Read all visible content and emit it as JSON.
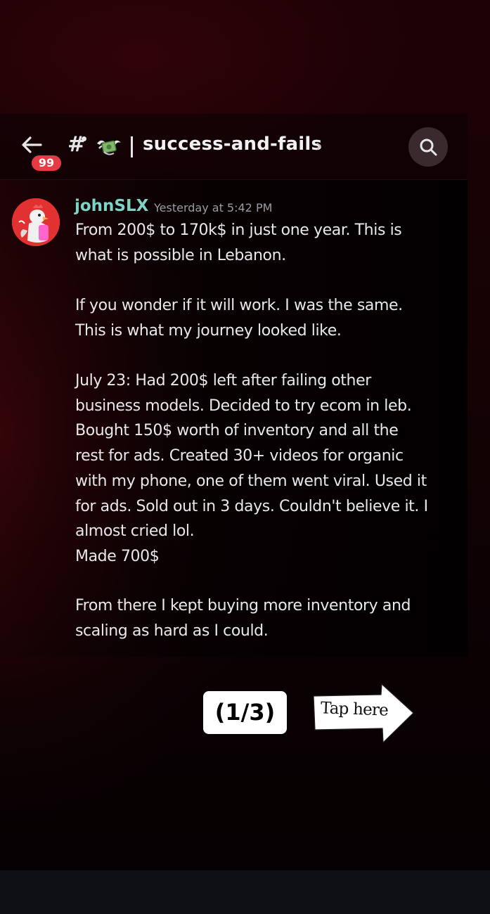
{
  "header": {
    "back_icon": "arrow-left-icon",
    "unread_count": "99",
    "hash_symbol": "#",
    "channel_emoji_icon": "money-with-wings-icon",
    "channel_name": "success-and-fails",
    "chevron": "›",
    "search_icon": "search-icon"
  },
  "message": {
    "author": "johnSLX",
    "author_color": "#7fd3c4",
    "timestamp": "Yesterday at 5:42 PM",
    "paragraphs": [
      {
        "lines": [
          "From 200$ to 170k$ in just one year. This is",
          "what is possible in Lebanon."
        ]
      },
      {
        "lines": [
          "If you wonder if it will work. I was the same.",
          "This is what my journey looked like."
        ]
      },
      {
        "lines": [
          "July 23: Had 200$ left after failing other",
          "business models. Decided to try ecom in leb.",
          "Bought 150$ worth of inventory and all the",
          "rest for ads. Created 30+ videos for organic",
          "with my phone, one of them went viral. Used it",
          "for ads. Sold out in 3 days. Couldn't believe it. I",
          "almost cried lol.",
          "Made 700$"
        ]
      },
      {
        "lines": [
          "From there I kept buying more inventory and",
          "scaling as hard as I could."
        ]
      }
    ]
  },
  "overlay": {
    "page_indicator": "(1/3)",
    "tap_label": "Tap here"
  },
  "colors": {
    "badge": "#e53b45",
    "background": "#150205"
  }
}
